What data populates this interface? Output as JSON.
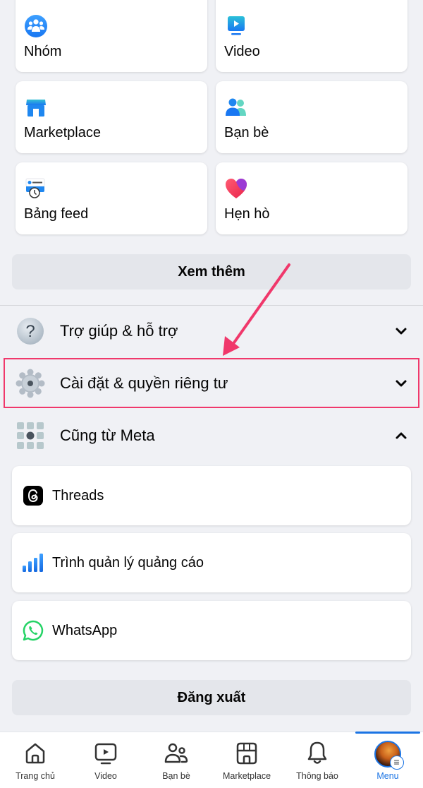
{
  "shortcuts": [
    {
      "label": "Nhóm",
      "icon": "groups-icon"
    },
    {
      "label": "Video",
      "icon": "video-icon"
    },
    {
      "label": "Marketplace",
      "icon": "marketplace-icon"
    },
    {
      "label": "Bạn bè",
      "icon": "friends-icon"
    },
    {
      "label": "Bảng feed",
      "icon": "feeds-icon"
    },
    {
      "label": "Hẹn hò",
      "icon": "dating-heart-icon"
    }
  ],
  "see_more_label": "Xem thêm",
  "sections": [
    {
      "label": "Trợ giúp & hỗ trợ",
      "icon": "help-question-icon",
      "expanded": false
    },
    {
      "label": "Cài đặt & quyền riêng tư",
      "icon": "settings-gear-icon",
      "expanded": false,
      "highlighted": true
    },
    {
      "label": "Cũng từ Meta",
      "icon": "meta-apps-grid-icon",
      "expanded": true
    }
  ],
  "meta_apps": [
    {
      "label": "Threads",
      "icon": "threads-icon"
    },
    {
      "label": "Trình quản lý quảng cáo",
      "icon": "ads-manager-icon"
    },
    {
      "label": "WhatsApp",
      "icon": "whatsapp-icon"
    }
  ],
  "logout_label": "Đăng xuất",
  "tabbar": {
    "items": [
      {
        "label": "Trang chủ",
        "icon": "home-icon"
      },
      {
        "label": "Video",
        "icon": "video-play-icon"
      },
      {
        "label": "Bạn bè",
        "icon": "friends-icon"
      },
      {
        "label": "Marketplace",
        "icon": "marketplace-store-icon"
      },
      {
        "label": "Thông báo",
        "icon": "bell-icon"
      },
      {
        "label": "Menu",
        "icon": "avatar-menu-icon",
        "active": true
      }
    ]
  },
  "colors": {
    "accent": "#1b74e4",
    "annotation": "#f0386b",
    "background": "#f0f1f5"
  }
}
